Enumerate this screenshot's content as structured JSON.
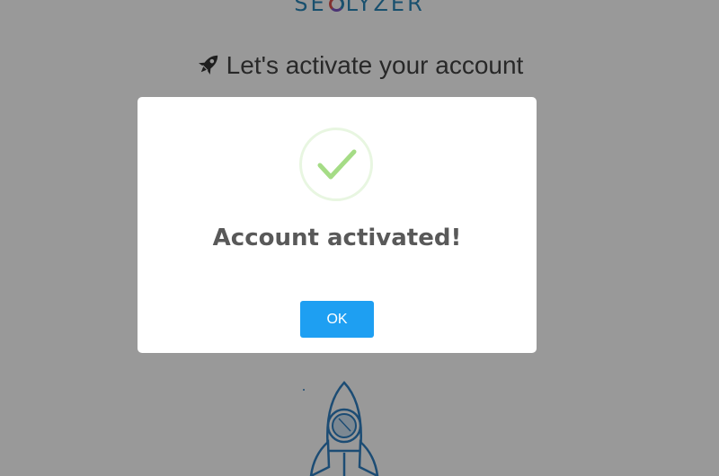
{
  "brand": {
    "logo_left": "SE",
    "logo_right": "LYZER"
  },
  "page": {
    "headline": "Let's activate your account",
    "headline_icon": "rocket-icon",
    "illustration": "rocket-illustration"
  },
  "modal": {
    "icon": "success-check-icon",
    "title": "Account activated!",
    "ok_label": "OK"
  },
  "colors": {
    "accent": "#1e9ff2",
    "success": "#a5dc86",
    "brand": "#2a86b8",
    "overlay": "rgba(0,0,0,0.4)"
  }
}
